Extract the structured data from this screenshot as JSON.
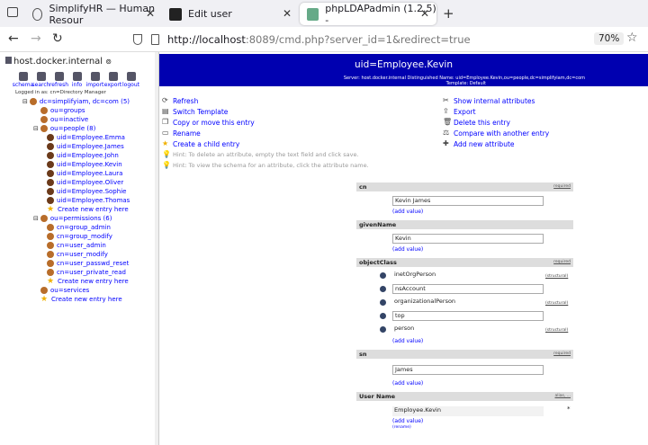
{
  "browser": {
    "tabs": [
      {
        "label": "SimplifyHR — Human Resour",
        "active": false
      },
      {
        "label": "Edit user",
        "active": false
      },
      {
        "label": "phpLDAPadmin (1.2.5) -",
        "active": true
      }
    ],
    "url_host": "http://localhost",
    "url_rest": ":8089/cmd.php?server_id=1&redirect=true",
    "zoom": "70%"
  },
  "sidebar": {
    "host": "host.docker.internal",
    "tools": [
      "schema",
      "search",
      "refresh",
      "info",
      "import",
      "export",
      "logout"
    ],
    "logged_in": "Logged in as: cn=Directory Manager",
    "tree": [
      {
        "label": "dc=simplifyiam, dc=com (5)",
        "level": 0,
        "icon": "folder",
        "exp": "⊟"
      },
      {
        "label": "ou=groups",
        "level": 1,
        "icon": "folder"
      },
      {
        "label": "ou=inactive",
        "level": 1,
        "icon": "folder"
      },
      {
        "label": "ou=people (8)",
        "level": 1,
        "icon": "folder",
        "exp": "⊟"
      },
      {
        "label": "uid=Employee.Emma",
        "level": 2,
        "icon": "person"
      },
      {
        "label": "uid=Employee.James",
        "level": 2,
        "icon": "person"
      },
      {
        "label": "uid=Employee.John",
        "level": 2,
        "icon": "person"
      },
      {
        "label": "uid=Employee.Kevin",
        "level": 2,
        "icon": "person"
      },
      {
        "label": "uid=Employee.Laura",
        "level": 2,
        "icon": "person"
      },
      {
        "label": "uid=Employee.Oliver",
        "level": 2,
        "icon": "person"
      },
      {
        "label": "uid=Employee.Sophie",
        "level": 2,
        "icon": "person"
      },
      {
        "label": "uid=Employee.Thomas",
        "level": 2,
        "icon": "person"
      },
      {
        "label": "Create new entry here",
        "level": 2,
        "icon": "star"
      },
      {
        "label": "ou=permissions (6)",
        "level": 1,
        "icon": "folder",
        "exp": "⊟"
      },
      {
        "label": "cn=group_admin",
        "level": 2,
        "icon": "folder"
      },
      {
        "label": "cn=group_modify",
        "level": 2,
        "icon": "folder"
      },
      {
        "label": "cn=user_admin",
        "level": 2,
        "icon": "folder"
      },
      {
        "label": "cn=user_modify",
        "level": 2,
        "icon": "folder"
      },
      {
        "label": "cn=user_passwd_reset",
        "level": 2,
        "icon": "folder"
      },
      {
        "label": "cn=user_private_read",
        "level": 2,
        "icon": "folder"
      },
      {
        "label": "Create new entry here",
        "level": 2,
        "icon": "star"
      },
      {
        "label": "ou=services",
        "level": 1,
        "icon": "folder"
      },
      {
        "label": "Create new entry here",
        "level": 1,
        "icon": "star"
      }
    ]
  },
  "main": {
    "title": "uid=Employee.Kevin",
    "server_line": "Server: host.docker.internal    Distinguished Name: uid=Employee.Kevin,ou=people,dc=simplifyiam,dc=com",
    "template_line": "Template: Default",
    "actions_left": [
      "Refresh",
      "Switch Template",
      "Copy or move this entry",
      "Rename",
      "Create a child entry"
    ],
    "hints": [
      "Hint: To delete an attribute, empty the text field and click save.",
      "Hint: To view the schema for an attribute, click the attribute name."
    ],
    "actions_right": [
      "Show internal attributes",
      "Export",
      "Delete this entry",
      "Compare with another entry",
      "Add new attribute"
    ],
    "required": "required",
    "add_value": "(add value)",
    "structural": "(structural)",
    "rename": "(rename)",
    "alias": "alias, ...",
    "attrs": {
      "cn": {
        "name": "cn",
        "value": "Kevin James"
      },
      "givenName": {
        "name": "givenName",
        "value": "Kevin"
      },
      "objectClass": {
        "name": "objectClass",
        "values": [
          "inetOrgPerson",
          "nsAccount",
          "organizationalPerson",
          "top",
          "person"
        ]
      },
      "sn": {
        "name": "sn",
        "value": "James"
      },
      "userName": {
        "name": "User Name",
        "value": "Employee.Kevin"
      }
    }
  }
}
